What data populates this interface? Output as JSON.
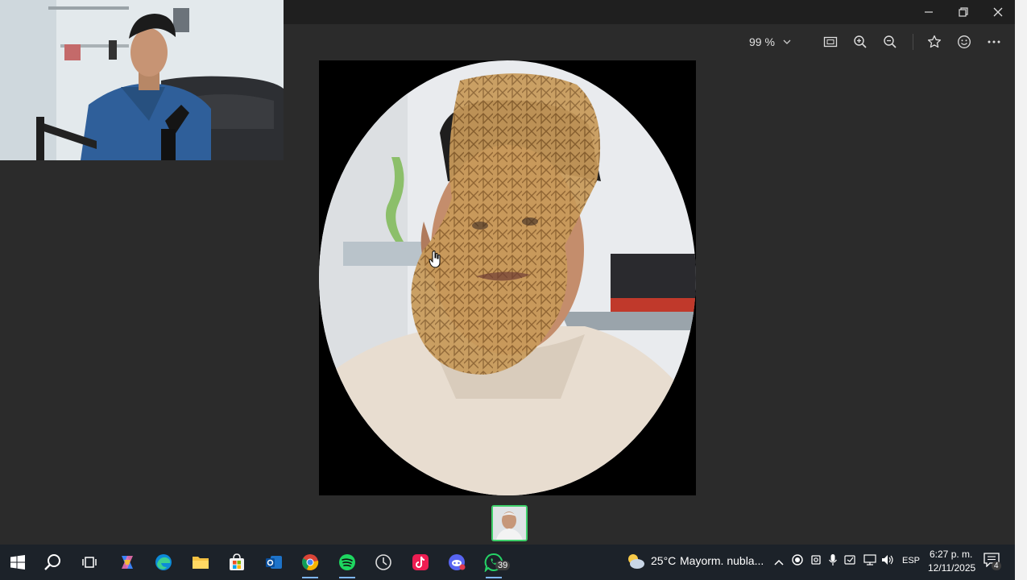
{
  "window": {
    "minimize_icon": "minimize-icon",
    "restore_icon": "restore-icon",
    "close_icon": "close-icon"
  },
  "toolbar": {
    "zoom_level": "99 %",
    "buttons": [
      "fit-to-window-icon",
      "zoom-in-icon",
      "zoom-out-icon",
      "favorite-star-icon",
      "emoji-react-icon",
      "more-options-icon"
    ]
  },
  "viewer": {
    "thumbnail_count": 1
  },
  "taskbar": {
    "apps": [
      "windows-start-icon",
      "search-icon",
      "task-view-icon",
      "copilot-icon",
      "edge-icon",
      "file-explorer-icon",
      "microsoft-store-icon",
      "outlook-icon",
      "chrome-icon",
      "spotify-icon",
      "clock-app-icon",
      "tiktok-icon",
      "discord-icon",
      "whatsapp-icon"
    ],
    "whatsapp_badge": "39",
    "weather_temp": "25°C",
    "weather_desc": "Mayorm. nubla...",
    "language": "ESP",
    "time": "6:27 p. m.",
    "date": "12/11/2025",
    "notification_count": "4"
  },
  "colors": {
    "background": "#2b2b2b",
    "titlebar": "#1f1f1f",
    "taskbar": "#1c2229",
    "thumb_border": "#3ecf6a"
  }
}
